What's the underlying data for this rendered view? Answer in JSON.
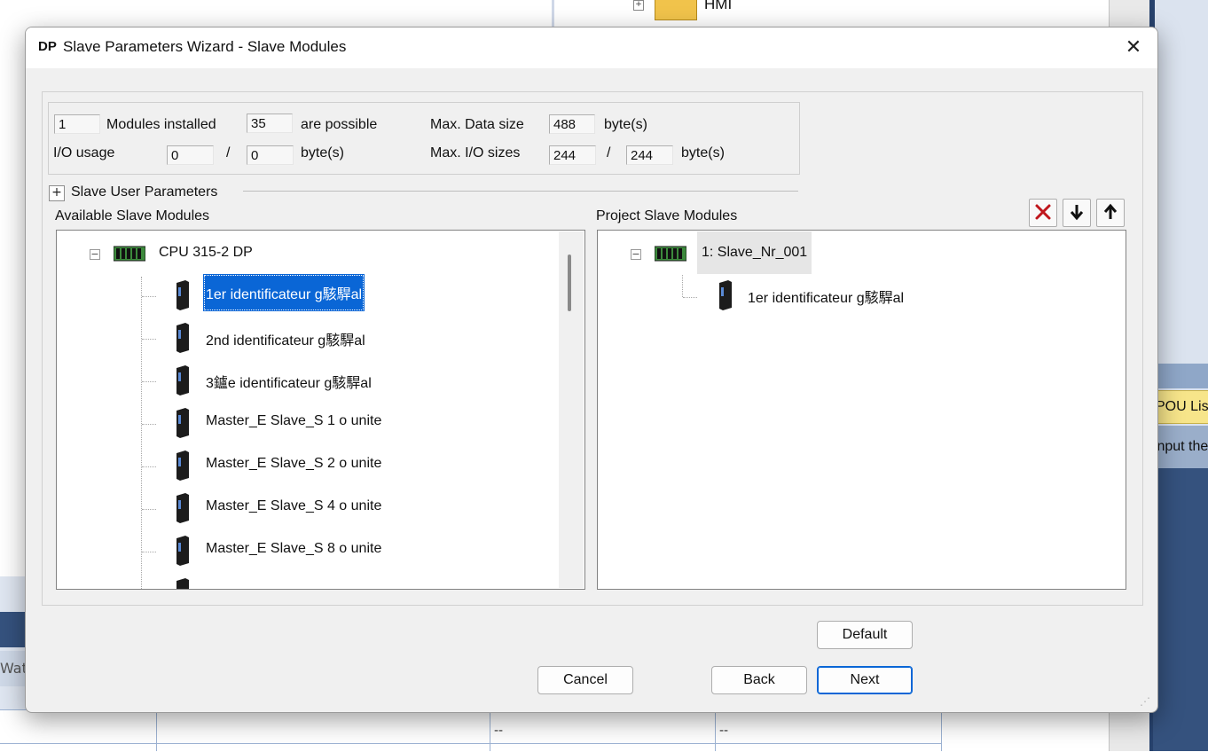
{
  "background": {
    "hmi_label": "HMI",
    "pou_tab": "POU List",
    "input_hint": "Input the",
    "watch_tab": "Watch",
    "table_cells": [
      "--",
      "--"
    ]
  },
  "dialog": {
    "title_prefix": "DP",
    "title": "Slave Parameters Wizard - Slave Modules",
    "close_glyph": "✕"
  },
  "info": {
    "modules_installed_value": "1",
    "modules_installed_label": "Modules installed",
    "possible_value": "35",
    "possible_label": "are possible",
    "max_data_label": "Max. Data size",
    "max_data_value": "488",
    "max_data_unit": "byte(s)",
    "io_usage_label": "I/O usage",
    "io_in_value": "0",
    "io_sep": "/",
    "io_out_value": "0",
    "io_unit": "byte(s)",
    "max_io_label": "Max. I/O sizes",
    "max_io_in_value": "244",
    "max_io_sep": "/",
    "max_io_out_value": "244",
    "max_io_unit": "byte(s)"
  },
  "user_params": {
    "expander": "+",
    "label": "Slave User Parameters"
  },
  "available": {
    "label": "Available Slave Modules",
    "root": "CPU 315-2 DP",
    "root_expander": "−",
    "items": [
      "1er identificateur g駭駻al",
      "2nd identificateur g駭駻al",
      "3鑪e identificateur g駭駻al",
      "Master_E Slave_S  1 o unite",
      "Master_E Slave_S  2 o unite",
      "Master_E Slave_S  4 o unite",
      "Master_E Slave_S  8 o unite"
    ],
    "selected_index": 0
  },
  "project": {
    "label": "Project Slave Modules",
    "root": "1: Slave_Nr_001",
    "root_expander": "−",
    "items": [
      "1er identificateur g駭駻al"
    ]
  },
  "toolbar": {
    "delete_icon": "delete-icon",
    "down_icon": "arrow-down-icon",
    "up_icon": "arrow-up-icon",
    "delete_color": "#c0161c"
  },
  "buttons": {
    "default": "Default",
    "cancel": "Cancel",
    "back": "Back",
    "next": "Next"
  },
  "colors": {
    "selection": "#0a66d6",
    "window_bg": "#f0f0f0"
  }
}
